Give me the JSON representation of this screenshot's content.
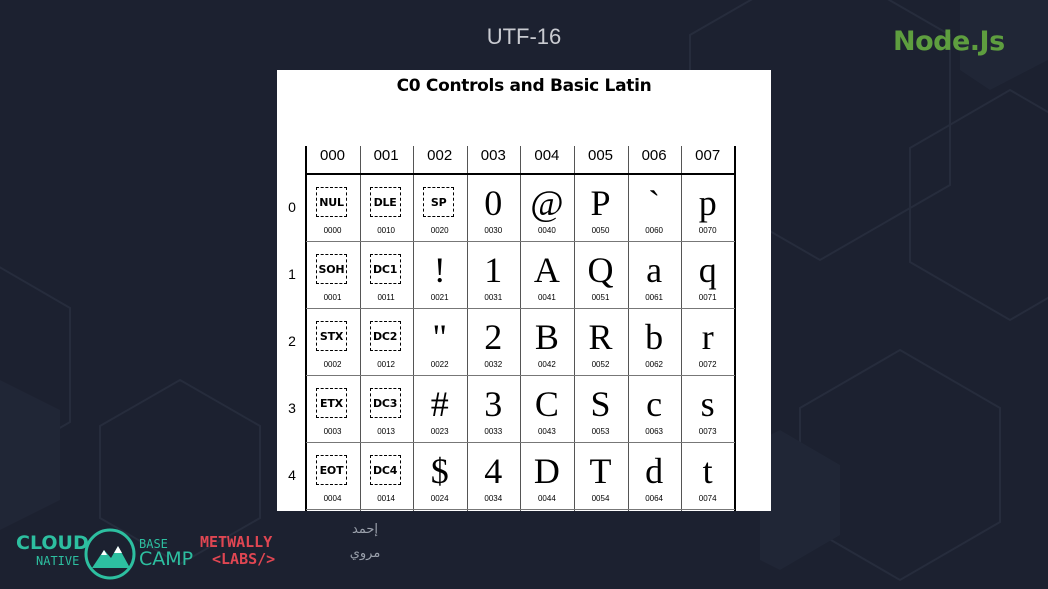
{
  "slide": {
    "title": "UTF-16",
    "logo_text": "Node.Js",
    "logo_color": "#5e9e3f",
    "background_color": "#1c2130"
  },
  "table": {
    "title": "C0 Controls and Basic Latin",
    "columns": [
      "000",
      "001",
      "002",
      "003",
      "004",
      "005",
      "006",
      "007"
    ],
    "rows": [
      {
        "label": "0",
        "cells": [
          {
            "glyph": "NUL",
            "control": true,
            "code": "0000"
          },
          {
            "glyph": "DLE",
            "control": true,
            "code": "0010"
          },
          {
            "glyph": "SP",
            "control": true,
            "code": "0020"
          },
          {
            "glyph": "0",
            "control": false,
            "code": "0030"
          },
          {
            "glyph": "@",
            "control": false,
            "code": "0040"
          },
          {
            "glyph": "P",
            "control": false,
            "code": "0050"
          },
          {
            "glyph": "`",
            "control": false,
            "code": "0060"
          },
          {
            "glyph": "p",
            "control": false,
            "code": "0070"
          }
        ]
      },
      {
        "label": "1",
        "cells": [
          {
            "glyph": "SOH",
            "control": true,
            "code": "0001"
          },
          {
            "glyph": "DC1",
            "control": true,
            "code": "0011"
          },
          {
            "glyph": "!",
            "control": false,
            "code": "0021"
          },
          {
            "glyph": "1",
            "control": false,
            "code": "0031"
          },
          {
            "glyph": "A",
            "control": false,
            "code": "0041"
          },
          {
            "glyph": "Q",
            "control": false,
            "code": "0051"
          },
          {
            "glyph": "a",
            "control": false,
            "code": "0061"
          },
          {
            "glyph": "q",
            "control": false,
            "code": "0071"
          }
        ]
      },
      {
        "label": "2",
        "cells": [
          {
            "glyph": "STX",
            "control": true,
            "code": "0002"
          },
          {
            "glyph": "DC2",
            "control": true,
            "code": "0012"
          },
          {
            "glyph": "\"",
            "control": false,
            "code": "0022"
          },
          {
            "glyph": "2",
            "control": false,
            "code": "0032"
          },
          {
            "glyph": "B",
            "control": false,
            "code": "0042"
          },
          {
            "glyph": "R",
            "control": false,
            "code": "0052"
          },
          {
            "glyph": "b",
            "control": false,
            "code": "0062"
          },
          {
            "glyph": "r",
            "control": false,
            "code": "0072"
          }
        ]
      },
      {
        "label": "3",
        "cells": [
          {
            "glyph": "ETX",
            "control": true,
            "code": "0003"
          },
          {
            "glyph": "DC3",
            "control": true,
            "code": "0013"
          },
          {
            "glyph": "#",
            "control": false,
            "code": "0023"
          },
          {
            "glyph": "3",
            "control": false,
            "code": "0033"
          },
          {
            "glyph": "C",
            "control": false,
            "code": "0043"
          },
          {
            "glyph": "S",
            "control": false,
            "code": "0053"
          },
          {
            "glyph": "c",
            "control": false,
            "code": "0063"
          },
          {
            "glyph": "s",
            "control": false,
            "code": "0073"
          }
        ]
      },
      {
        "label": "4",
        "cells": [
          {
            "glyph": "EOT",
            "control": true,
            "code": "0004"
          },
          {
            "glyph": "DC4",
            "control": true,
            "code": "0014"
          },
          {
            "glyph": "$",
            "control": false,
            "code": "0024"
          },
          {
            "glyph": "4",
            "control": false,
            "code": "0034"
          },
          {
            "glyph": "D",
            "control": false,
            "code": "0044"
          },
          {
            "glyph": "T",
            "control": false,
            "code": "0054"
          },
          {
            "glyph": "d",
            "control": false,
            "code": "0064"
          },
          {
            "glyph": "t",
            "control": false,
            "code": "0074"
          }
        ]
      }
    ]
  },
  "footer": {
    "cloud_line1": "CLOUD",
    "cloud_line2": "NATIVE",
    "base_line1": "BASE",
    "base_line2": "CAMP",
    "metwally_line1": "METWALLY",
    "metwally_line2": "<LABS/>",
    "cloud_color": "#2dbfa0",
    "metwally_color": "#e04652",
    "arabic_line1": "إحمد",
    "arabic_line2": "مروي"
  }
}
